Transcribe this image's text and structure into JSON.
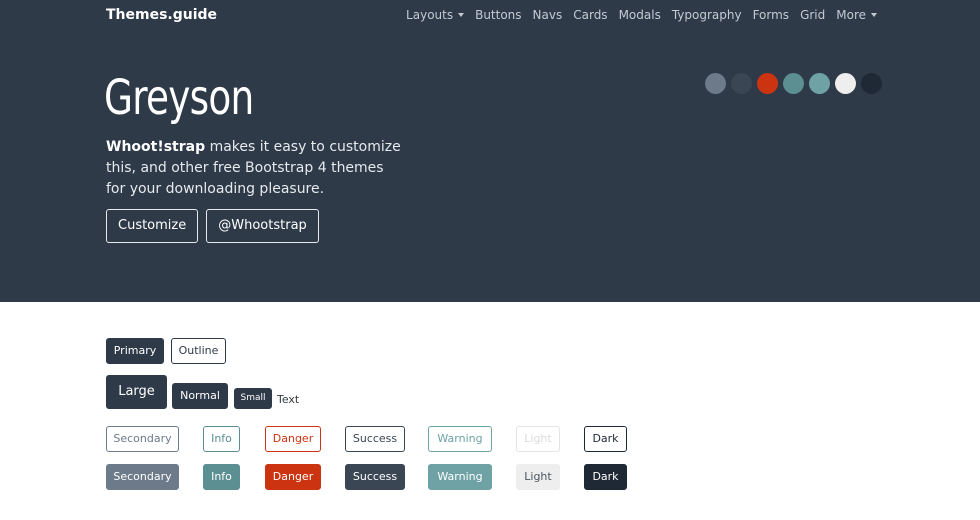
{
  "navbar": {
    "brand": "Themes.guide",
    "items": [
      {
        "label": "Layouts",
        "dropdown": true
      },
      {
        "label": "Buttons",
        "dropdown": false
      },
      {
        "label": "Navs",
        "dropdown": false
      },
      {
        "label": "Cards",
        "dropdown": false
      },
      {
        "label": "Modals",
        "dropdown": false
      },
      {
        "label": "Typography",
        "dropdown": false
      },
      {
        "label": "Forms",
        "dropdown": false
      },
      {
        "label": "Grid",
        "dropdown": false
      },
      {
        "label": "More",
        "dropdown": true
      }
    ]
  },
  "swatches": [
    "#6c7a89",
    "#3b4654",
    "#cc3311",
    "#5c8f91",
    "#6ea2a4",
    "#eeeeee",
    "#1f2935"
  ],
  "hero": {
    "title": "Greyson",
    "lead_brand": "Whoot!strap",
    "lead_text": " makes it easy to customize this, and other free Bootstrap 4 themes for your downloading pleasure.",
    "customize_label": "Customize",
    "twitter_label": "@Whootstrap"
  },
  "buttons": {
    "primary": "Primary",
    "outline": "Outline",
    "large": "Large",
    "normal": "Normal",
    "small": "Small",
    "text": "Text"
  },
  "variants": [
    {
      "label": "Secondary",
      "color": "#6c7a89"
    },
    {
      "label": "Info",
      "color": "#5c8f91"
    },
    {
      "label": "Danger",
      "color": "#cc3311"
    },
    {
      "label": "Success",
      "color": "#3b4654"
    },
    {
      "label": "Warning",
      "color": "#6ea2a4"
    },
    {
      "label": "Light",
      "color": "#eeeeee"
    },
    {
      "label": "Dark",
      "color": "#1f2935"
    }
  ]
}
